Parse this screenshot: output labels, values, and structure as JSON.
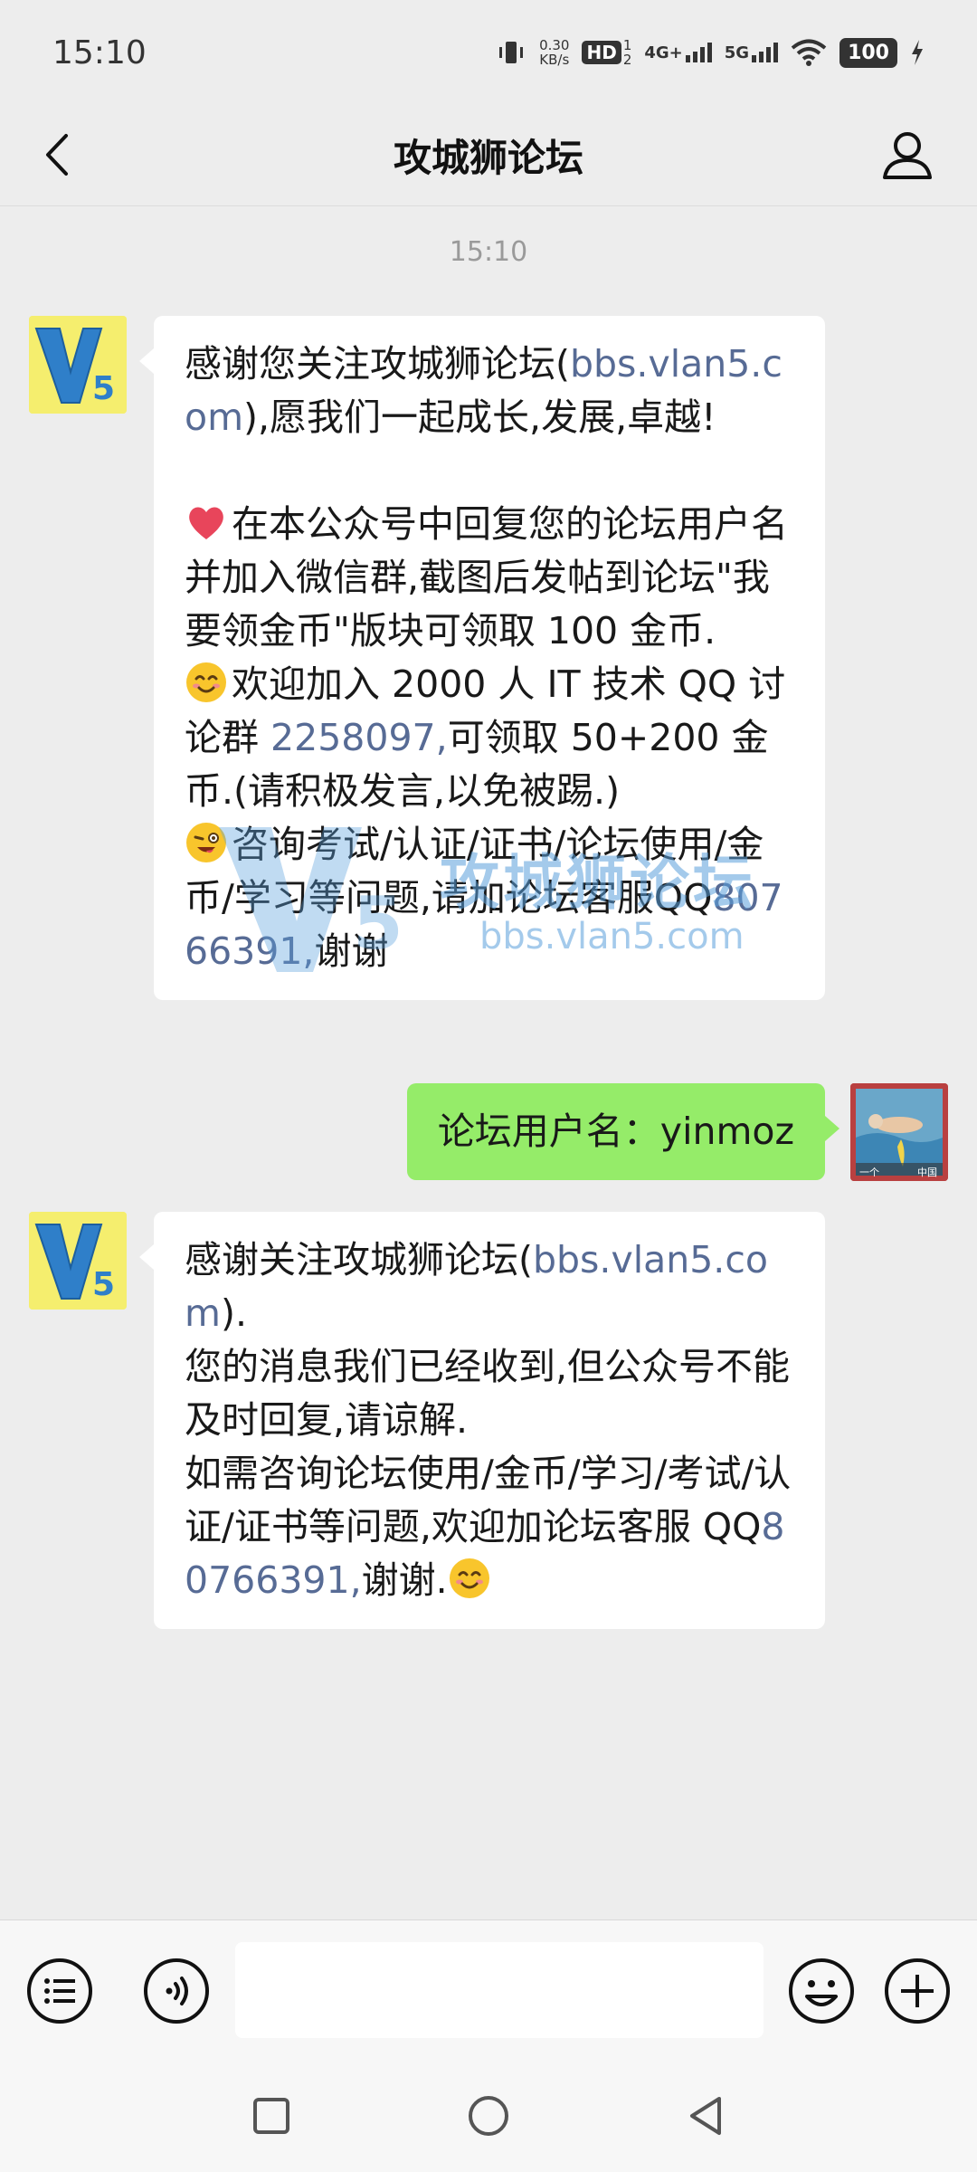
{
  "status_bar": {
    "time": "15:10",
    "net_speed_value": "0.30",
    "net_speed_unit": "KB/s",
    "hd_label": "HD",
    "hd_sim": "1",
    "hd_sim2": "2",
    "network_1": "4G+",
    "network_2": "5G",
    "battery": "100"
  },
  "nav": {
    "title": "攻城狮论坛"
  },
  "chat": {
    "timestamp": "15:10",
    "messages": [
      {
        "sender": "bot",
        "segments": [
          {
            "text": "感谢您关注攻城狮论坛(",
            "type": "text"
          },
          {
            "text": "bbs.vlan5.com",
            "type": "link"
          },
          {
            "text": "),愿我们一起成长,发展,卓越!\n\n",
            "type": "text"
          },
          {
            "text": "❤",
            "type": "emoji-heart"
          },
          {
            "text": "在本公众号中回复您的论坛用户名并加入微信群,截图后发帖到论坛\"我要领金币\"版块可领取 100 金币.\n",
            "type": "text"
          },
          {
            "text": "😊",
            "type": "emoji-smile"
          },
          {
            "text": "欢迎加入 2000 人 IT 技术 QQ 讨论群 ",
            "type": "text"
          },
          {
            "text": "2258097,",
            "type": "link"
          },
          {
            "text": "可领取 50+200 金币.(请积极发言,以免被踢.)\n",
            "type": "text"
          },
          {
            "text": "😜",
            "type": "emoji-wink"
          },
          {
            "text": "咨询考试/认证/证书/论坛使用/金币/学习等问题,请加论坛客服QQ",
            "type": "text"
          },
          {
            "text": "80766391,",
            "type": "link"
          },
          {
            "text": "谢谢",
            "type": "text"
          }
        ]
      },
      {
        "sender": "me",
        "text": "论坛用户名：yinmoz",
        "avatar_caption_left": "一个",
        "avatar_caption_right": "中国"
      },
      {
        "sender": "bot",
        "segments": [
          {
            "text": "感谢关注攻城狮论坛(",
            "type": "text"
          },
          {
            "text": "bbs.vlan5.com",
            "type": "link"
          },
          {
            "text": ").\n您的消息我们已经收到,但公众号不能及时回复,请谅解.\n如需咨询论坛使用/金币/学习/考试/认证/证书等问题,欢迎加论坛客服 QQ",
            "type": "text"
          },
          {
            "text": "80766391,",
            "type": "link"
          },
          {
            "text": "谢谢.",
            "type": "text"
          },
          {
            "text": "😊",
            "type": "emoji-smile"
          }
        ]
      }
    ],
    "bot_avatar_text": "V5",
    "watermark_text": "攻城狮论坛",
    "watermark_url": "bbs.vlan5.com"
  },
  "colors": {
    "link": "#576b95",
    "my_bubble": "#95ec69",
    "background": "#ededed"
  },
  "icons": {
    "back": "chevron-left-icon",
    "profile": "person-icon",
    "menu": "list-menu-icon",
    "voice": "voice-icon",
    "emoji": "smile-face-icon",
    "plus": "plus-circle-icon",
    "recent": "square-icon",
    "home": "circle-icon",
    "back_nav": "triangle-back-icon"
  }
}
